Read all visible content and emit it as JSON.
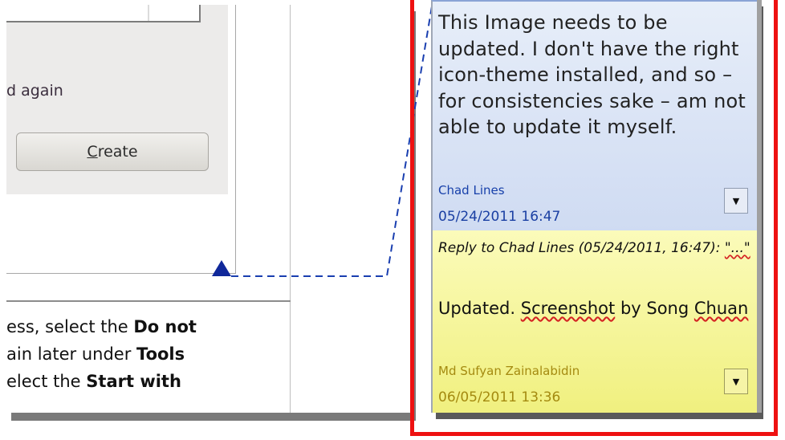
{
  "dialog": {
    "partial_label": "d again",
    "create_button_mnemonic": "C",
    "create_button_rest": "reate"
  },
  "document": {
    "lines": [
      {
        "pre": "ess, select the ",
        "bold": "Do not",
        "post": ""
      },
      {
        "pre": "ain later under ",
        "bold": "Tools",
        "post": ""
      },
      {
        "pre": "elect the ",
        "bold": "Start with",
        "post": ""
      }
    ]
  },
  "comments": [
    {
      "text": "This Image needs to be updated. I don't have the right icon-theme installed, and so – for consistencies sake – am not able to update it myself.",
      "author": "Chad Lines",
      "date": "05/24/2011 16:47",
      "menu_icon": "dropdown-arrow-icon",
      "color": "#cfdbf2"
    },
    {
      "reply_to": "Reply to Chad Lines (05/24/2011, 16:47): ",
      "reply_quote": "\"...\"",
      "text_before": "Updated. ",
      "text_misspelled": "Screenshot",
      "text_middle": " by Song ",
      "text_misspelled2": "Chuan",
      "author": "Md Sufyan Zainalabidin",
      "date": "06/05/2011 13:36",
      "menu_icon": "dropdown-arrow-icon",
      "color": "#f0f07f"
    }
  ],
  "colors": {
    "highlight_frame": "#ee1111",
    "anchor": "#10289a"
  }
}
